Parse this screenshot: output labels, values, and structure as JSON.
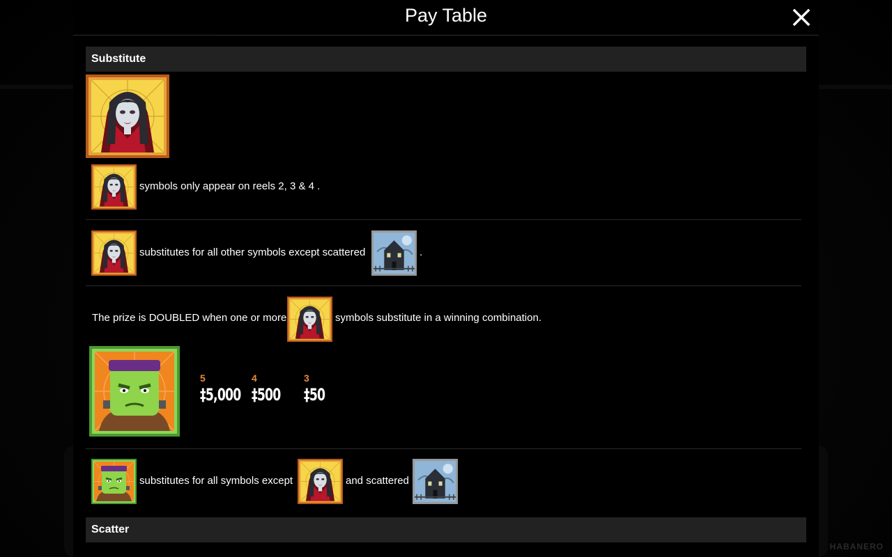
{
  "header": {
    "title": "Pay Table"
  },
  "sections": {
    "substitute_title": "Substitute",
    "scatter_title": "Scatter"
  },
  "rows": {
    "reels_text": "symbols only appear on reels 2, 3 & 4 .",
    "substitutes_text": "substitutes for all other symbols except scattered",
    "substitutes_end": ".",
    "doubled_before": "The prize is DOUBLED when one or more",
    "doubled_after": "symbols substitute in a winning combination.",
    "frank_before": "substitutes for all symbols except",
    "frank_middle": "and scattered"
  },
  "paytable": {
    "frankenstein": [
      {
        "count": "5",
        "value": "‡5,000"
      },
      {
        "count": "4",
        "value": "‡500"
      },
      {
        "count": "3",
        "value": "‡50"
      }
    ]
  },
  "icons": {
    "vampire": "vampire-wild-icon",
    "frankenstein": "frankenstein-wild-icon",
    "house": "haunted-house-scatter-icon",
    "close": "close-icon"
  },
  "colors": {
    "accent": "#e8893a",
    "section_bg": "#222222",
    "vampire_frame": "#c8601c",
    "frank_frame": "#5fae3c"
  },
  "watermark": "HABANERO"
}
